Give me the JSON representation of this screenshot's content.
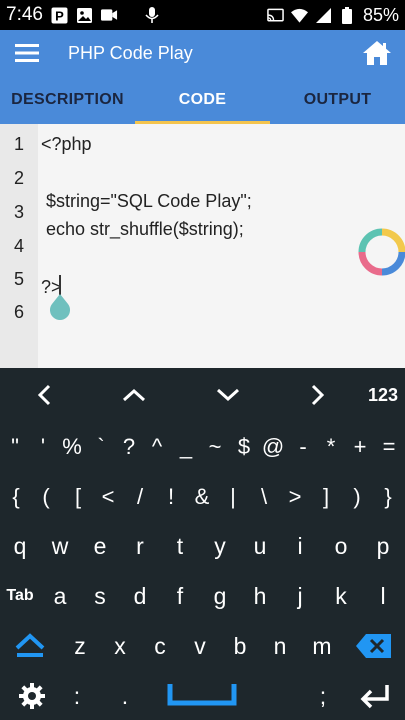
{
  "status_bar": {
    "time": "7:46",
    "battery_text": "85%",
    "left_icons": [
      "parking-icon",
      "photo-icon",
      "video-icon",
      "microphone-icon"
    ],
    "right_icons": [
      "cast-icon",
      "wifi-icon",
      "signal-icon",
      "battery-icon"
    ]
  },
  "app_bar": {
    "title": "PHP Code Play",
    "menu_icon": "hamburger-menu-icon",
    "home_icon": "home-icon",
    "color": "#4a8ad9"
  },
  "tabs": [
    {
      "label": "DESCRIPTION",
      "active": false
    },
    {
      "label": "CODE",
      "active": true
    },
    {
      "label": "OUTPUT",
      "active": false
    }
  ],
  "editor": {
    "line_numbers": [
      "1",
      "2",
      "3",
      "4",
      "5",
      "6"
    ],
    "lines": [
      "<?php",
      "",
      " $string=\"SQL Code Play\";",
      " echo str_shuffle($string);",
      "",
      "?>"
    ]
  },
  "keyboard": {
    "nav_row": [
      "‹",
      "˄",
      "˅",
      "›",
      "123"
    ],
    "symbol_row_1": [
      "\"",
      "'",
      "%",
      "`",
      "?",
      "^",
      "_",
      "~",
      "$",
      "@",
      "-",
      "*",
      "+",
      "="
    ],
    "symbol_row_2": [
      "{",
      "(",
      "[",
      "<",
      "/",
      "!",
      "&",
      "|",
      "\\",
      ">",
      "]",
      ")",
      "}"
    ],
    "letter_row_1": [
      "q",
      "w",
      "e",
      "r",
      "t",
      "y",
      "u",
      "i",
      "o",
      "p"
    ],
    "letter_row_2": [
      "Tab",
      "a",
      "s",
      "d",
      "f",
      "g",
      "h",
      "j",
      "k",
      "l"
    ],
    "letter_row_3": [
      "z",
      "x",
      "c",
      "v",
      "b",
      "n",
      "m"
    ],
    "bottom_row": [
      ":",
      ".",
      ";"
    ],
    "accent_color": "#2196f3"
  }
}
